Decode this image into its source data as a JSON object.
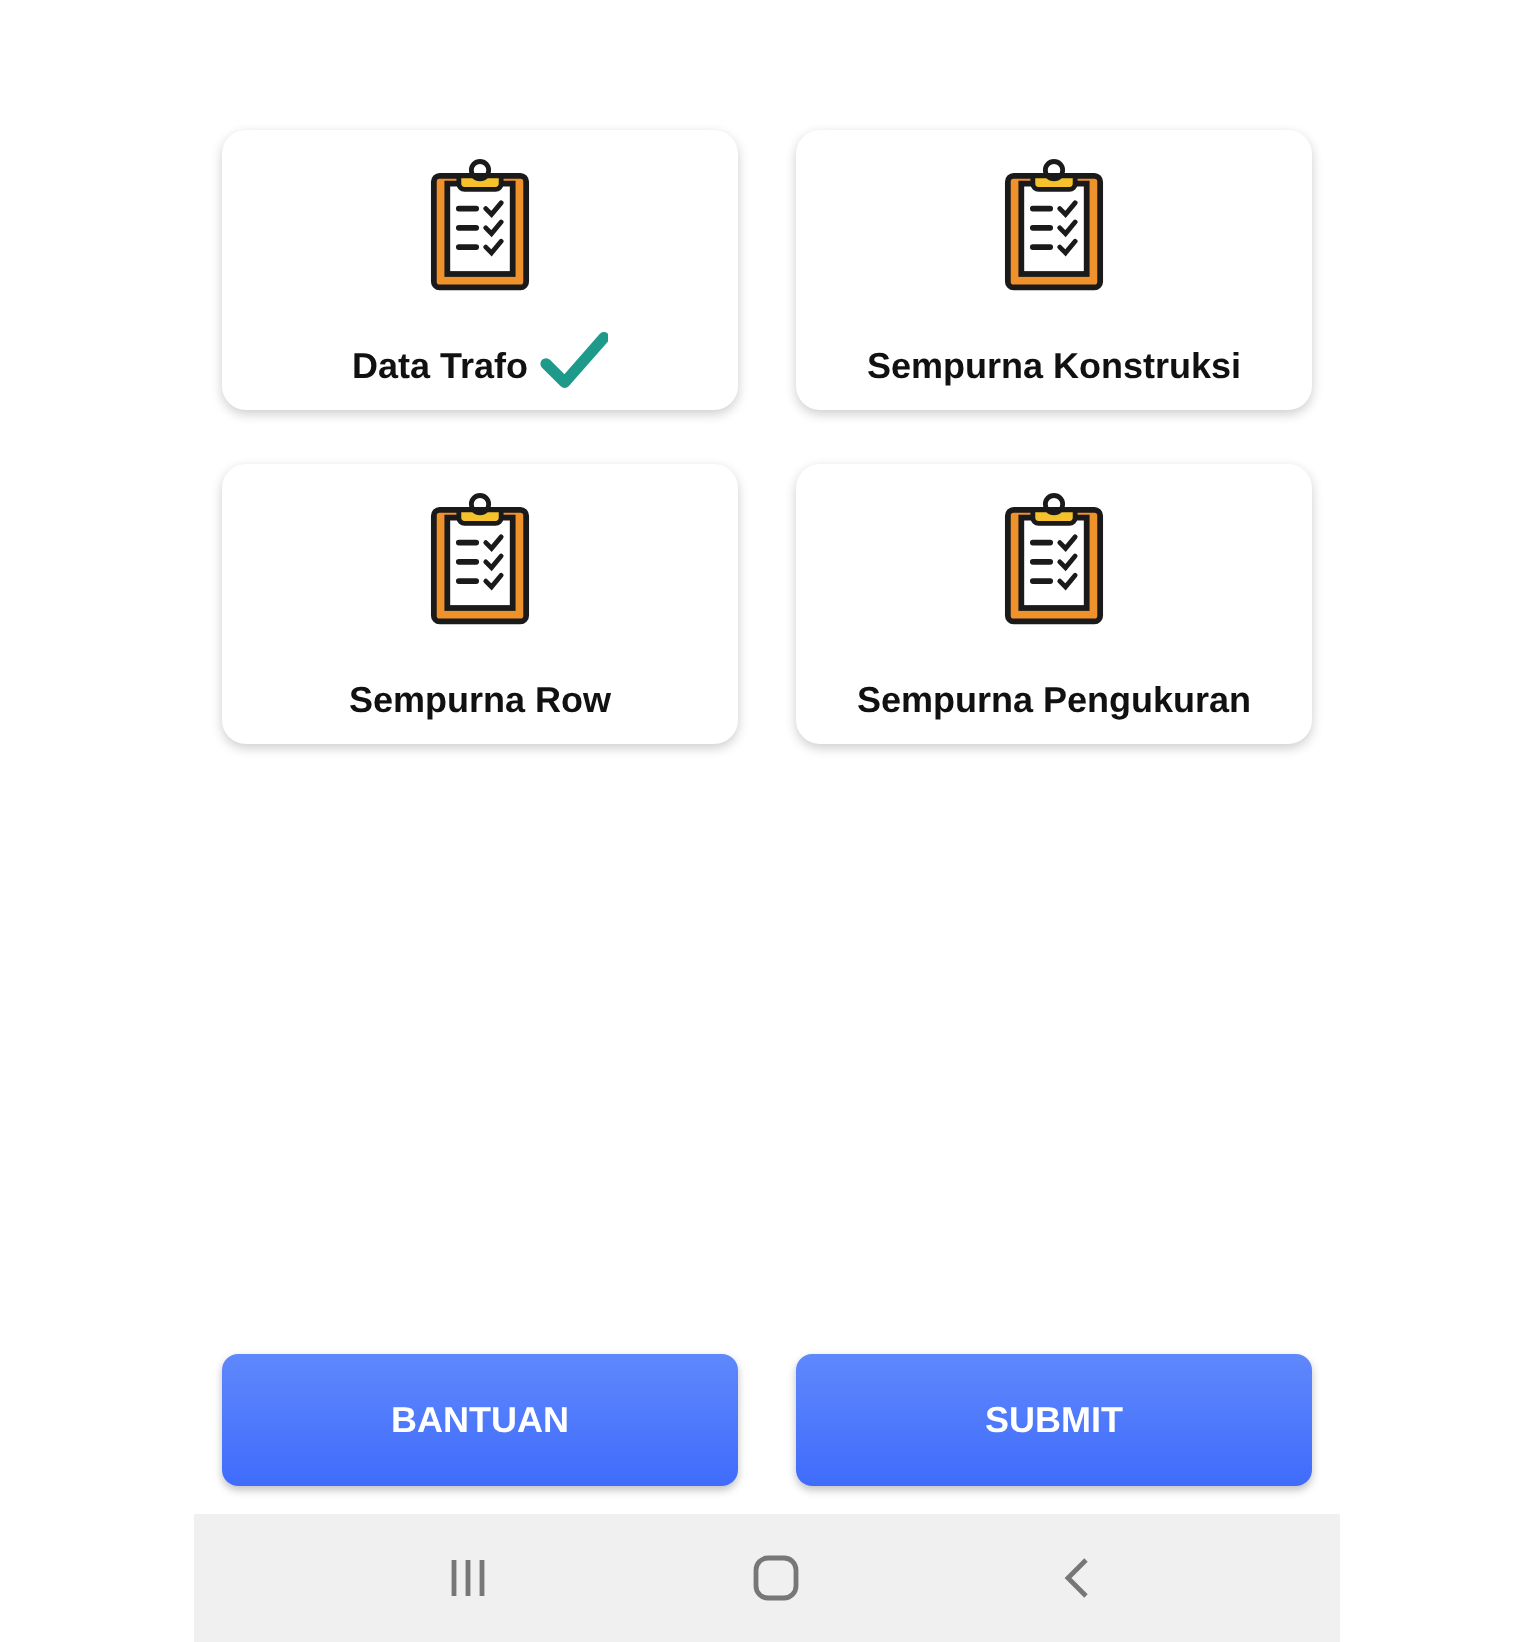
{
  "menu_cards": [
    {
      "label": "Data Trafo",
      "done": true
    },
    {
      "label": "Sempurna Konstruksi",
      "done": false
    },
    {
      "label": "Sempurna Row",
      "done": false
    },
    {
      "label": "Sempurna Pengukuran",
      "done": false
    }
  ],
  "buttons": [
    {
      "label": "BANTUAN"
    },
    {
      "label": "SUBMIT"
    }
  ]
}
